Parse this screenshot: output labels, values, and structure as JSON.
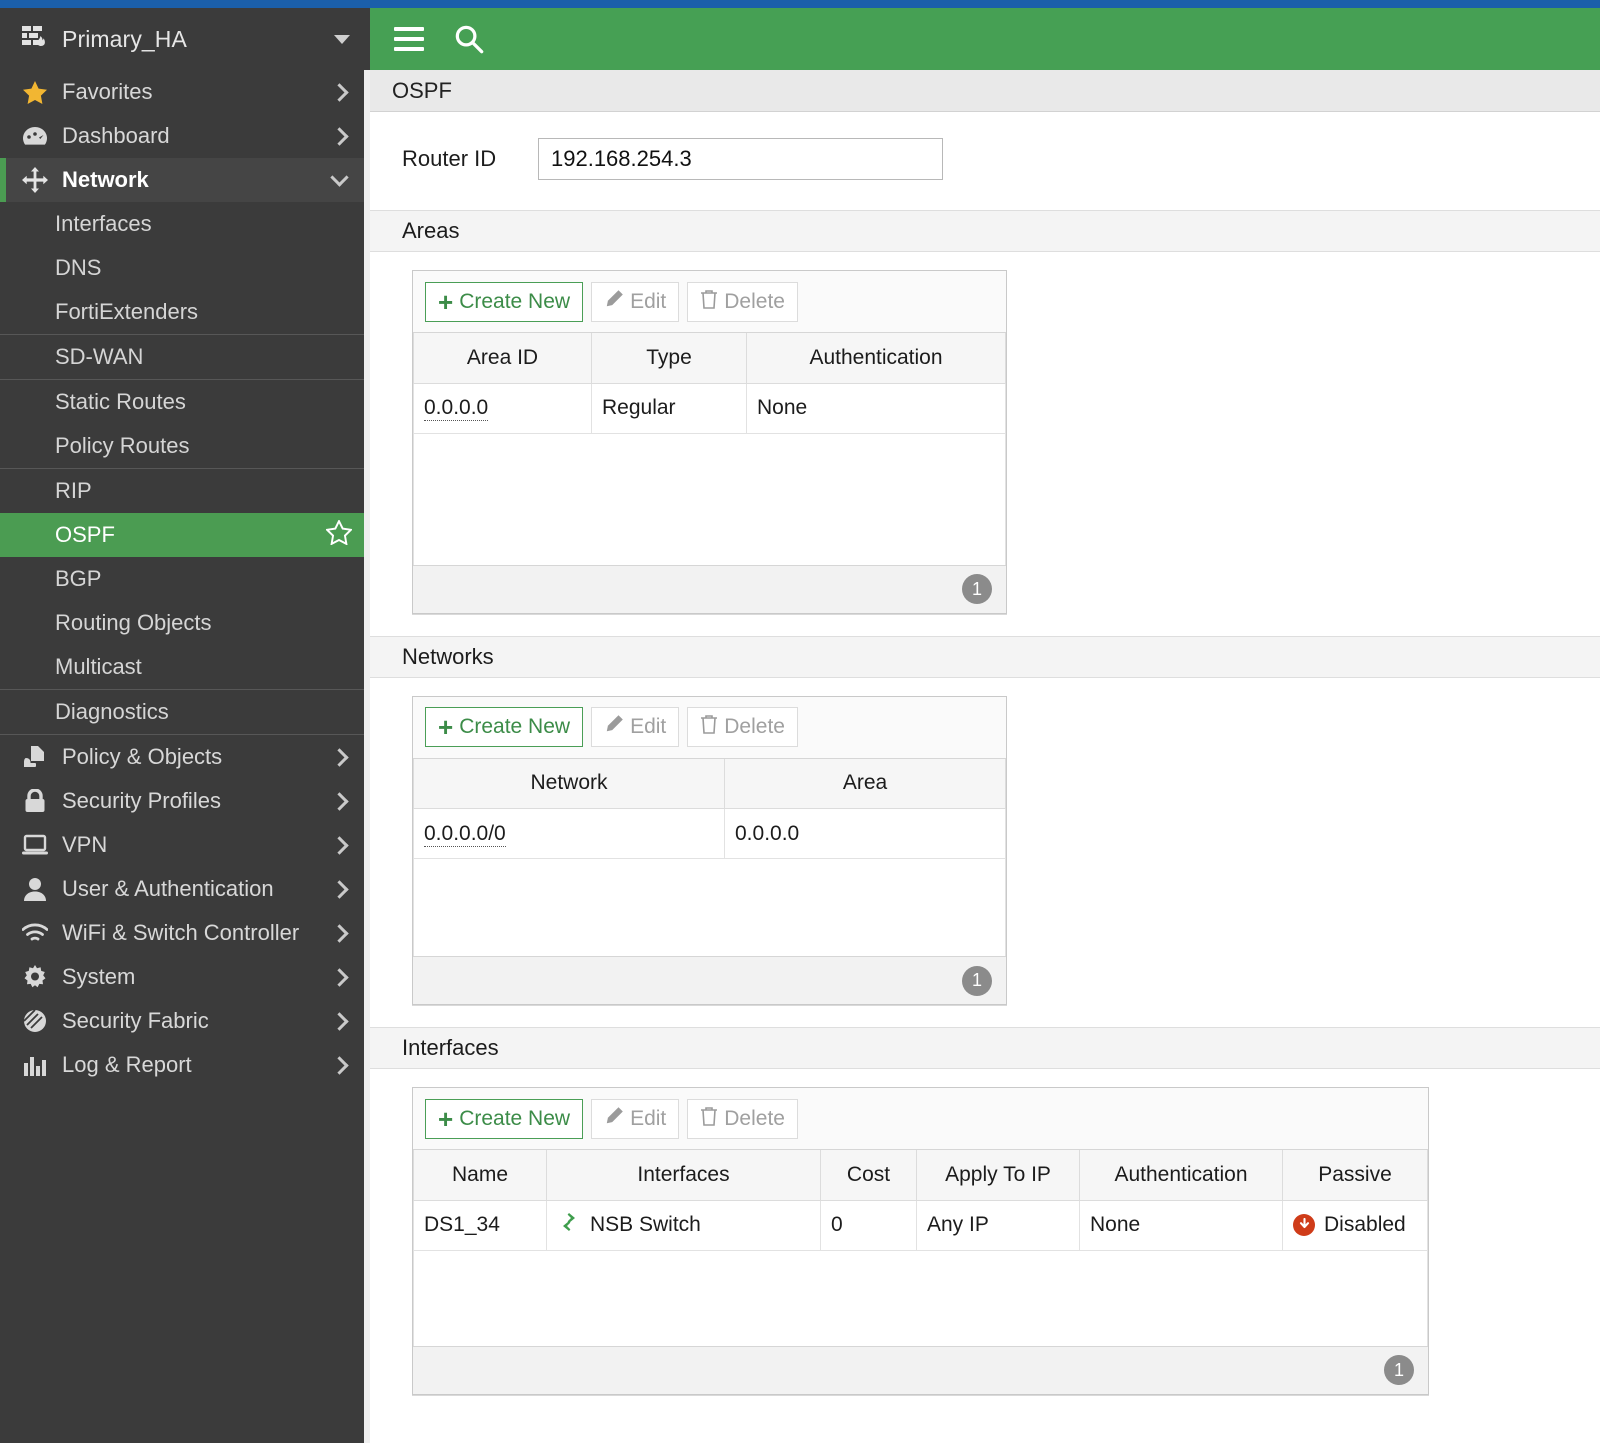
{
  "theme": {
    "accent_green": "#46a054",
    "top_strip_blue": "#1b5faa",
    "sidebar_bg": "#3b3b3b",
    "selected_green": "#4b9c52",
    "disabled_red": "#cf3c19"
  },
  "sidebar": {
    "vdom": {
      "label": "Primary_HA",
      "icon": "firewall-icon",
      "caret": "chevron-down-icon"
    },
    "items": [
      {
        "label": "Favorites",
        "icon": "star-icon",
        "chevron": "right",
        "type": "parent"
      },
      {
        "label": "Dashboard",
        "icon": "dashboard-icon",
        "chevron": "right",
        "type": "parent"
      },
      {
        "label": "Network",
        "icon": "network-move-icon",
        "chevron": "down",
        "type": "parent",
        "active": true
      }
    ],
    "network_children": [
      {
        "label": "Interfaces",
        "divider_after": false
      },
      {
        "label": "DNS",
        "divider_after": false
      },
      {
        "label": "FortiExtenders",
        "divider_after": true
      },
      {
        "label": "SD-WAN",
        "divider_after": true
      },
      {
        "label": "Static Routes",
        "divider_after": false
      },
      {
        "label": "Policy Routes",
        "divider_after": true
      },
      {
        "label": "RIP",
        "divider_after": false
      },
      {
        "label": "OSPF",
        "selected": true,
        "star": "star-outline-icon",
        "divider_after": false
      },
      {
        "label": "BGP",
        "divider_after": false
      },
      {
        "label": "Routing Objects",
        "divider_after": false
      },
      {
        "label": "Multicast",
        "divider_after": true
      },
      {
        "label": "Diagnostics",
        "divider_after": true
      }
    ],
    "bottom_items": [
      {
        "label": "Policy & Objects",
        "icon": "policy-objects-icon",
        "chevron": "right"
      },
      {
        "label": "Security Profiles",
        "icon": "lock-icon",
        "chevron": "right"
      },
      {
        "label": "VPN",
        "icon": "laptop-icon",
        "chevron": "right"
      },
      {
        "label": "User & Authentication",
        "icon": "user-icon",
        "chevron": "right"
      },
      {
        "label": "WiFi & Switch Controller",
        "icon": "wifi-icon",
        "chevron": "right"
      },
      {
        "label": "System",
        "icon": "gear-icon",
        "chevron": "right"
      },
      {
        "label": "Security Fabric",
        "icon": "security-fabric-icon",
        "chevron": "right"
      },
      {
        "label": "Log & Report",
        "icon": "bar-chart-icon",
        "chevron": "right"
      }
    ]
  },
  "topbar": {
    "menu_icon": "hamburger-icon",
    "search_icon": "search-icon"
  },
  "page": {
    "title": "OSPF"
  },
  "router": {
    "label": "Router ID",
    "value": "192.168.254.3"
  },
  "toolbar_labels": {
    "create_new": "Create New",
    "edit": "Edit",
    "delete": "Delete",
    "plus": "+",
    "edit_icon": "pencil-icon",
    "delete_icon": "trash-icon"
  },
  "areas": {
    "title": "Areas",
    "columns": [
      "Area ID",
      "Type",
      "Authentication"
    ],
    "rows": [
      {
        "area_id": "0.0.0.0",
        "type": "Regular",
        "authentication": "None"
      }
    ],
    "count": "1"
  },
  "networks": {
    "title": "Networks",
    "columns": [
      "Network",
      "Area"
    ],
    "rows": [
      {
        "network": "0.0.0.0/0",
        "area": "0.0.0.0"
      }
    ],
    "count": "1"
  },
  "interfaces": {
    "title": "Interfaces",
    "columns": [
      "Name",
      "Interfaces",
      "Cost",
      "Apply To IP",
      "Authentication",
      "Passive"
    ],
    "rows": [
      {
        "name": "DS1_34",
        "interface": "NSB Switch",
        "interface_icon": "switch-icon",
        "cost": "0",
        "apply_to_ip": "Any IP",
        "authentication": "None",
        "passive": "Disabled",
        "passive_icon": "disabled-down-icon"
      }
    ],
    "count": "1"
  }
}
